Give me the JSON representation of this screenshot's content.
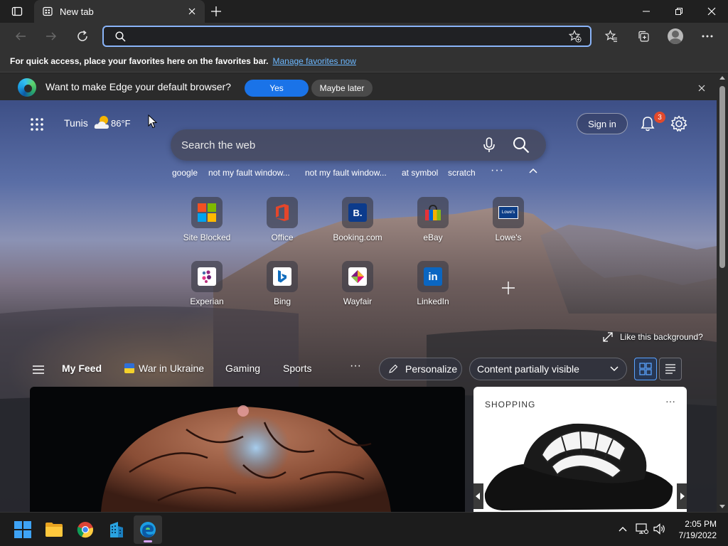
{
  "browser": {
    "tab_title": "New tab",
    "address": {
      "value": "",
      "placeholder": ""
    }
  },
  "favorites_bar": {
    "message": "For quick access, place your favorites here on the favorites bar.",
    "link": "Manage favorites now"
  },
  "default_prompt": {
    "message": "Want to make Edge your default browser?",
    "yes_label": "Yes",
    "later_label": "Maybe later"
  },
  "header": {
    "city": "Tunis",
    "temperature": "86",
    "temperature_unit": "°F",
    "sign_in_label": "Sign in",
    "notification_count": "3"
  },
  "search": {
    "placeholder": "Search the web",
    "suggestions": [
      "google",
      "not my fault window...",
      "not my fault window...",
      "at symbol",
      "scratch"
    ],
    "more_label": "···"
  },
  "quick_links": [
    {
      "label": "Site Blocked",
      "icon": "microsoft-icon"
    },
    {
      "label": "Office",
      "icon": "office-icon"
    },
    {
      "label": "Booking.com",
      "icon": "booking-icon",
      "glyph": "B."
    },
    {
      "label": "eBay",
      "icon": "ebay-icon"
    },
    {
      "label": "Lowe's",
      "icon": "lowes-icon",
      "glyph": "Lowe's"
    },
    {
      "label": "Experian",
      "icon": "experian-icon"
    },
    {
      "label": "Bing",
      "icon": "bing-icon"
    },
    {
      "label": "Wayfair",
      "icon": "wayfair-icon"
    },
    {
      "label": "LinkedIn",
      "icon": "linkedin-icon",
      "glyph": "in"
    }
  ],
  "background_prompt": "Like this background?",
  "feed": {
    "tabs": [
      "My Feed",
      "War in Ukraine",
      "Gaming",
      "Sports"
    ],
    "more_label": "···",
    "personalize_label": "Personalize",
    "visibility_label": "Content partially visible"
  },
  "shopping_card": {
    "label": "SHOPPING",
    "more_label": "···"
  },
  "taskbar": {
    "time": "2:05 PM",
    "date": "7/19/2022"
  },
  "colors": {
    "accent": "#1a73e8",
    "address_border": "#8ab4f8",
    "link": "#6cb8ff",
    "badge": "#e2492b"
  }
}
